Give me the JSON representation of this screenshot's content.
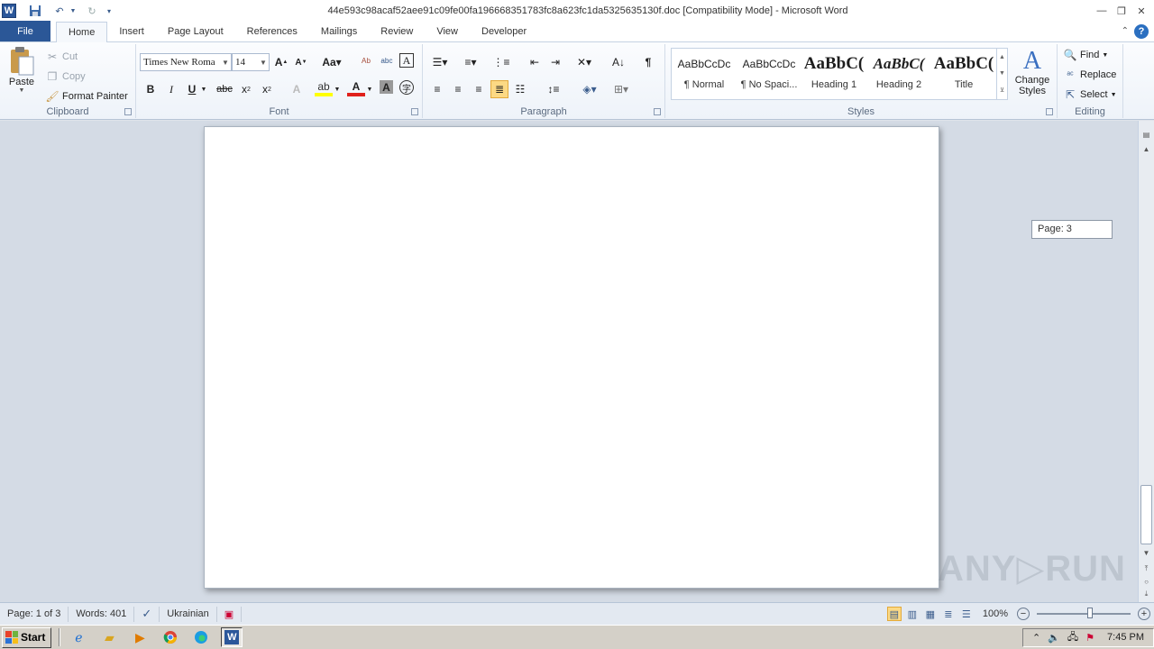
{
  "title_bar": {
    "title": "44e593c98acaf52aee91c09fe00fa196668351783fc8a623fc1da5325635130f.doc [Compatibility Mode]  -  Microsoft Word",
    "app_icon": "W"
  },
  "tabs": {
    "file": "File",
    "items": [
      "Home",
      "Insert",
      "Page Layout",
      "References",
      "Mailings",
      "Review",
      "View",
      "Developer"
    ],
    "active": "Home"
  },
  "ribbon": {
    "clipboard": {
      "label": "Clipboard",
      "paste": "Paste",
      "cut": "Cut",
      "copy": "Copy",
      "format_painter": "Format Painter"
    },
    "font": {
      "label": "Font",
      "font_name": "Times New Roma",
      "font_size": "14"
    },
    "paragraph": {
      "label": "Paragraph"
    },
    "styles": {
      "label": "Styles",
      "items": [
        {
          "sample": "AaBbCcDc",
          "name": "¶ Normal"
        },
        {
          "sample": "AaBbCcDc",
          "name": "¶ No Spaci..."
        },
        {
          "sample": "AaBbC(",
          "name": "Heading 1"
        },
        {
          "sample": "AaBbC(",
          "name": "Heading 2"
        },
        {
          "sample": "AaBbC(",
          "name": "Title"
        }
      ],
      "change_styles_line1": "Change",
      "change_styles_line2": "Styles"
    },
    "editing": {
      "label": "Editing",
      "find": "Find",
      "replace": "Replace",
      "select": "Select"
    }
  },
  "document": {
    "page_tooltip": "Page: 3",
    "watermark": "ANY▷RUN"
  },
  "status_bar": {
    "page": "Page: 1 of 3",
    "words": "Words: 401",
    "language": "Ukrainian",
    "zoom": "100%"
  },
  "taskbar": {
    "start": "Start",
    "time": "7:45 PM"
  }
}
